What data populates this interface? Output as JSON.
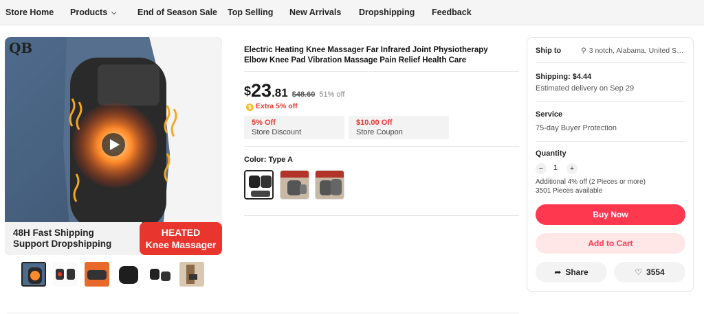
{
  "nav": {
    "items": [
      "Store Home",
      "Products",
      "End of Season Sale",
      "Top Selling",
      "New Arrivals",
      "Dropshipping",
      "Feedback"
    ]
  },
  "gallery": {
    "brand": "QB",
    "banner_left_line1": "48H Fast Shipping",
    "banner_left_line2": "Support Dropshipping",
    "banner_right_line1": "HEATED",
    "banner_right_line2": "Knee Massager"
  },
  "product": {
    "title": "Electric Heating Knee Massager Far Infrared Joint Physiotherapy Elbow Knee Pad Vibration Massage Pain Relief Health Care",
    "price_currency": "$",
    "price_int": "23",
    "price_dec": ".81",
    "original_price": "$48.60",
    "discount": "51% off",
    "extra_discount": "Extra 5% off",
    "coupons": [
      {
        "amount": "5% Off",
        "label": "Store Discount"
      },
      {
        "amount": "$10.00 Off",
        "label": "Store Coupon"
      }
    ],
    "color_label": "Color: Type A"
  },
  "panel": {
    "ship_to_label": "Ship to",
    "ship_to_value": "3 notch, Alabama, United St...",
    "shipping": "Shipping: $4.44",
    "delivery": "Estimated delivery on Sep 29",
    "service_label": "Service",
    "service_value": "75-day Buyer Protection",
    "quantity_label": "Quantity",
    "quantity_value": "1",
    "minus": "−",
    "plus": "+",
    "additional": "Additional 4% off (2 Pieces or more)",
    "available": "3501 Pieces available",
    "buy_now": "Buy Now",
    "add_to_cart": "Add to Cart",
    "share": "Share",
    "wishlist_count": "3554"
  },
  "colors": {
    "accent": "#fd384f",
    "discount_red": "#e8352e"
  }
}
